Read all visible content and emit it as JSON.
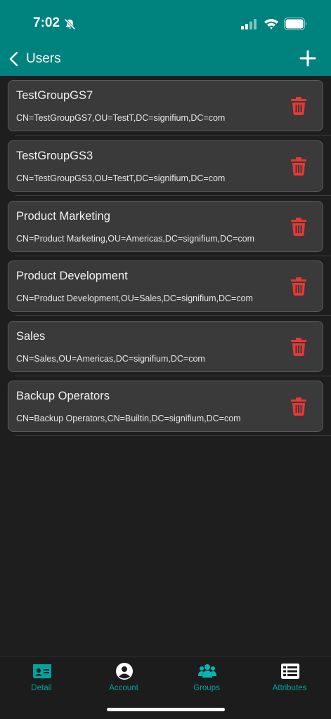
{
  "status_bar": {
    "time": "7:02"
  },
  "nav": {
    "back_label": "Users"
  },
  "groups": [
    {
      "name": "TestGroupGS7",
      "dn": "CN=TestGroupGS7,OU=TestT,DC=signifium,DC=com"
    },
    {
      "name": "TestGroupGS3",
      "dn": "CN=TestGroupGS3,OU=TestT,DC=signifium,DC=com"
    },
    {
      "name": "Product Marketing",
      "dn": "CN=Product Marketing,OU=Americas,DC=signifium,DC=com"
    },
    {
      "name": "Product Development",
      "dn": "CN=Product Development,OU=Sales,DC=signifium,DC=com"
    },
    {
      "name": "Sales",
      "dn": "CN=Sales,OU=Americas,DC=signifium,DC=com"
    },
    {
      "name": "Backup Operators",
      "dn": "CN=Backup Operators,CN=Builtin,DC=signifium,DC=com"
    }
  ],
  "tabs": [
    {
      "label": "Detail",
      "icon": "id-card-icon"
    },
    {
      "label": "Account",
      "icon": "user-circle-icon"
    },
    {
      "label": "Groups",
      "icon": "users-icon",
      "active": true
    },
    {
      "label": "Attributes",
      "icon": "list-icon"
    }
  ],
  "colors": {
    "header": "#00827f",
    "delete": "#e53935",
    "tab_inactive": "#00a3a0",
    "tab_active": "#00b8b4"
  }
}
